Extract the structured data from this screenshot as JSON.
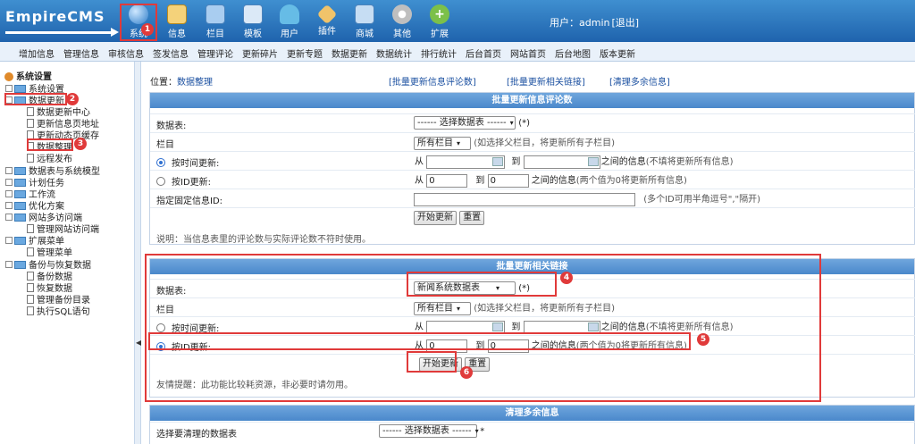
{
  "app": {
    "logo": "EmpireCMS"
  },
  "topnav": [
    {
      "label": "系统",
      "icon": "globe-icon",
      "color": "#4a90d9"
    },
    {
      "label": "信息",
      "icon": "edit-icon",
      "color": "#e5a53a"
    },
    {
      "label": "栏目",
      "icon": "folder-icon",
      "color": "#6aa8e0"
    },
    {
      "label": "模板",
      "icon": "template-icon",
      "color": "#9cc3e8"
    },
    {
      "label": "用户",
      "icon": "user-icon",
      "color": "#4ab0d9"
    },
    {
      "label": "插件",
      "icon": "tools-icon",
      "color": "#d9a04a"
    },
    {
      "label": "商城",
      "icon": "shop-icon",
      "color": "#8ab8e0"
    },
    {
      "label": "其他",
      "icon": "gear-icon",
      "color": "#bfbfbf"
    },
    {
      "label": "扩展",
      "icon": "plus-icon",
      "color": "#7cc04a"
    }
  ],
  "user": {
    "prefix": "用户：admin",
    "logout": "[退出]"
  },
  "subnav": [
    "增加信息",
    "管理信息",
    "审核信息",
    "签发信息",
    "管理评论",
    "更新碎片",
    "更新专题",
    "数据更新",
    "数据统计",
    "排行统计",
    "后台首页",
    "网站首页",
    "后台地图",
    "版本更新"
  ],
  "sidebar": {
    "root": "系统设置",
    "items": [
      {
        "label": "系统设置"
      },
      {
        "label": "数据更新"
      },
      {
        "label": "数据更新中心"
      },
      {
        "label": "更新信息页地址"
      },
      {
        "label": "更新动态页缓存"
      },
      {
        "label": "数据整理"
      },
      {
        "label": "远程发布"
      },
      {
        "label": "数据表与系统模型"
      },
      {
        "label": "计划任务"
      },
      {
        "label": "工作流"
      },
      {
        "label": "优化方案"
      },
      {
        "label": "网站多访问端"
      },
      {
        "label": "管理网站访问端"
      },
      {
        "label": "扩展菜单"
      },
      {
        "label": "管理菜单"
      },
      {
        "label": "备份与恢复数据"
      },
      {
        "label": "备份数据"
      },
      {
        "label": "恢复数据"
      },
      {
        "label": "管理备份目录"
      },
      {
        "label": "执行SQL语句"
      }
    ]
  },
  "breadcrumb": {
    "prefix": "位置：",
    "current": "数据整理"
  },
  "links": [
    "[批量更新信息评论数]",
    "[批量更新相关链接]",
    "[清理多余信息]"
  ],
  "panel1": {
    "title": "批量更新信息评论数",
    "table_label": "数据表:",
    "table_select": "------ 选择数据表 ------",
    "required": "(*)",
    "column_label": "栏目",
    "column_select": "所有栏目",
    "column_hint": "(如选择父栏目，将更新所有子栏目)",
    "by_time_label": "按时间更新:",
    "from": "从",
    "to": "到",
    "between_time": "之间的信息",
    "time_hint": "(不填将更新所有信息)",
    "by_id_label": "按ID更新:",
    "id_from": "0",
    "id_to": "0",
    "between_id": "之间的信息",
    "id_hint": "(两个值为0将更新所有信息)",
    "fixed_id_label": "指定固定信息ID:",
    "fixed_id_hint": "(多个ID可用半角逗号\",\"隔开)",
    "start_btn": "开始更新",
    "reset_btn": "重置",
    "note": "说明：当信息表里的评论数与实际评论数不符时使用。"
  },
  "panel2": {
    "title": "批量更新相关链接",
    "table_label": "数据表:",
    "table_select": "新闻系统数据表",
    "required": "(*)",
    "column_label": "栏目",
    "column_select": "所有栏目",
    "column_hint": "(如选择父栏目，将更新所有子栏目)",
    "by_time_label": "按时间更新:",
    "from": "从",
    "to": "到",
    "between_time": "之间的信息",
    "time_hint": "(不填将更新所有信息)",
    "by_id_label": "按ID更新:",
    "id_from": "0",
    "id_to": "0",
    "between_id": "之间的信息",
    "id_hint": "(两个值为0将更新所有信息)",
    "start_btn": "开始更新",
    "reset_btn": "重置",
    "note": "友情提醒：此功能比较耗资源，非必要时请勿用。"
  },
  "panel3": {
    "title": "清理多余信息",
    "table_label": "选择要清理的数据表",
    "table_select": "------ 选择数据表 ------",
    "required": "*"
  },
  "badges": [
    "1",
    "2",
    "3",
    "4",
    "5",
    "6"
  ],
  "highlight_color": "#e03a3a"
}
